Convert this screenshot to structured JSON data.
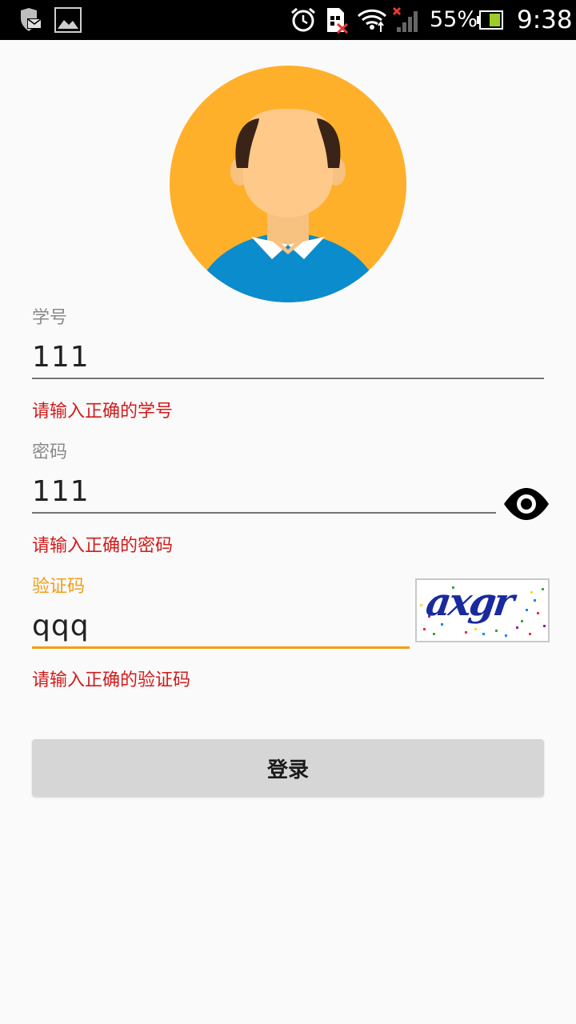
{
  "status_bar": {
    "battery_percent": "55%",
    "time": "9:38",
    "icons": [
      "shield-mail-icon",
      "image-icon",
      "alarm-icon",
      "sim-error-icon",
      "wifi-icon",
      "signal-icon",
      "battery-icon"
    ]
  },
  "avatar": {
    "icon": "user-avatar-icon"
  },
  "form": {
    "student_id": {
      "label": "学号",
      "value": "111",
      "error": "请输入正确的学号"
    },
    "password": {
      "label": "密码",
      "value": "111",
      "error": "请输入正确的密码",
      "toggle_icon": "eye-icon"
    },
    "captcha": {
      "label": "验证码",
      "value": "qqq",
      "error": "请输入正确的验证码",
      "image_text": "axgr"
    }
  },
  "login_button": {
    "label": "登录"
  },
  "colors": {
    "accent": "#f29d16",
    "error": "#d21b1b",
    "avatar_bg": "#ffb02a",
    "avatar_shirt": "#0b8ccc"
  }
}
